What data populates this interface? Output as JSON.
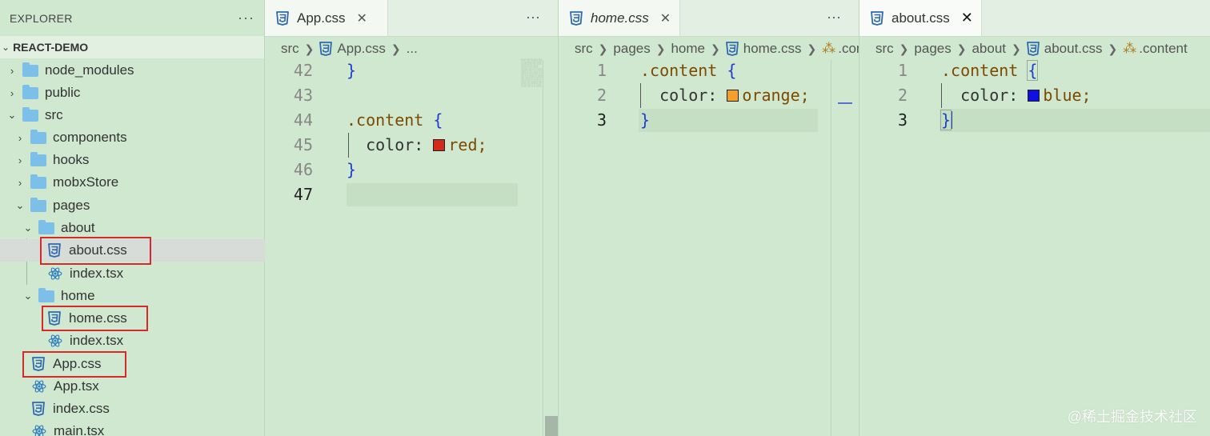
{
  "explorer": {
    "title": "EXPLORER",
    "more": "···",
    "project": "REACT-DEMO",
    "items": [
      {
        "label": "node_modules"
      },
      {
        "label": "public"
      },
      {
        "label": "src"
      },
      {
        "label": "components"
      },
      {
        "label": "hooks"
      },
      {
        "label": "mobxStore"
      },
      {
        "label": "pages"
      },
      {
        "label": "about"
      },
      {
        "label": "about.css"
      },
      {
        "label": "index.tsx"
      },
      {
        "label": "home"
      },
      {
        "label": "home.css"
      },
      {
        "label": "index.tsx"
      },
      {
        "label": "App.css"
      },
      {
        "label": "App.tsx"
      },
      {
        "label": "index.css"
      },
      {
        "label": "main.tsx"
      }
    ]
  },
  "editor1": {
    "tab": "App.css",
    "close": "✕",
    "more": "···",
    "crumbs": [
      "src",
      "App.css",
      "..."
    ],
    "lines": [
      {
        "n": "42",
        "code": "}"
      },
      {
        "n": "43",
        "code": ""
      },
      {
        "n": "44",
        "code": ".content {"
      },
      {
        "n": "45",
        "code": "color: red;"
      },
      {
        "n": "46",
        "code": "}"
      },
      {
        "n": "47",
        "code": ""
      }
    ],
    "selector": ".content",
    "open_brace": "{",
    "close_brace": "}",
    "property": "color:",
    "value": "red;",
    "swatch": "#d42a1a"
  },
  "editor2": {
    "tab": "home.css",
    "close": "✕",
    "more": "···",
    "crumbs": [
      "src",
      "pages",
      "home",
      "home.css",
      ".con"
    ],
    "lines": [
      {
        "n": "1"
      },
      {
        "n": "2"
      },
      {
        "n": "3"
      }
    ],
    "selector": ".content",
    "open_brace": "{",
    "close_brace": "}",
    "property": "color:",
    "value": "orange;",
    "swatch": "#f2a02b"
  },
  "editor3": {
    "tab": "about.css",
    "close": "✕",
    "crumbs": [
      "src",
      "pages",
      "about",
      "about.css",
      ".content"
    ],
    "lines": [
      {
        "n": "1"
      },
      {
        "n": "2"
      },
      {
        "n": "3"
      }
    ],
    "selector": ".content",
    "open_brace": "{",
    "close_brace": "}",
    "property": "color:",
    "value": "blue;",
    "swatch": "#1010e0"
  },
  "watermark": "@稀土掘金技术社区",
  "colors": {
    "background": "#cfe8cf",
    "highlight_box": "#d62a2a",
    "css_icon": "#2f6ab0",
    "react_icon": "#2b7bbf",
    "folder": "#7cc0ea"
  }
}
